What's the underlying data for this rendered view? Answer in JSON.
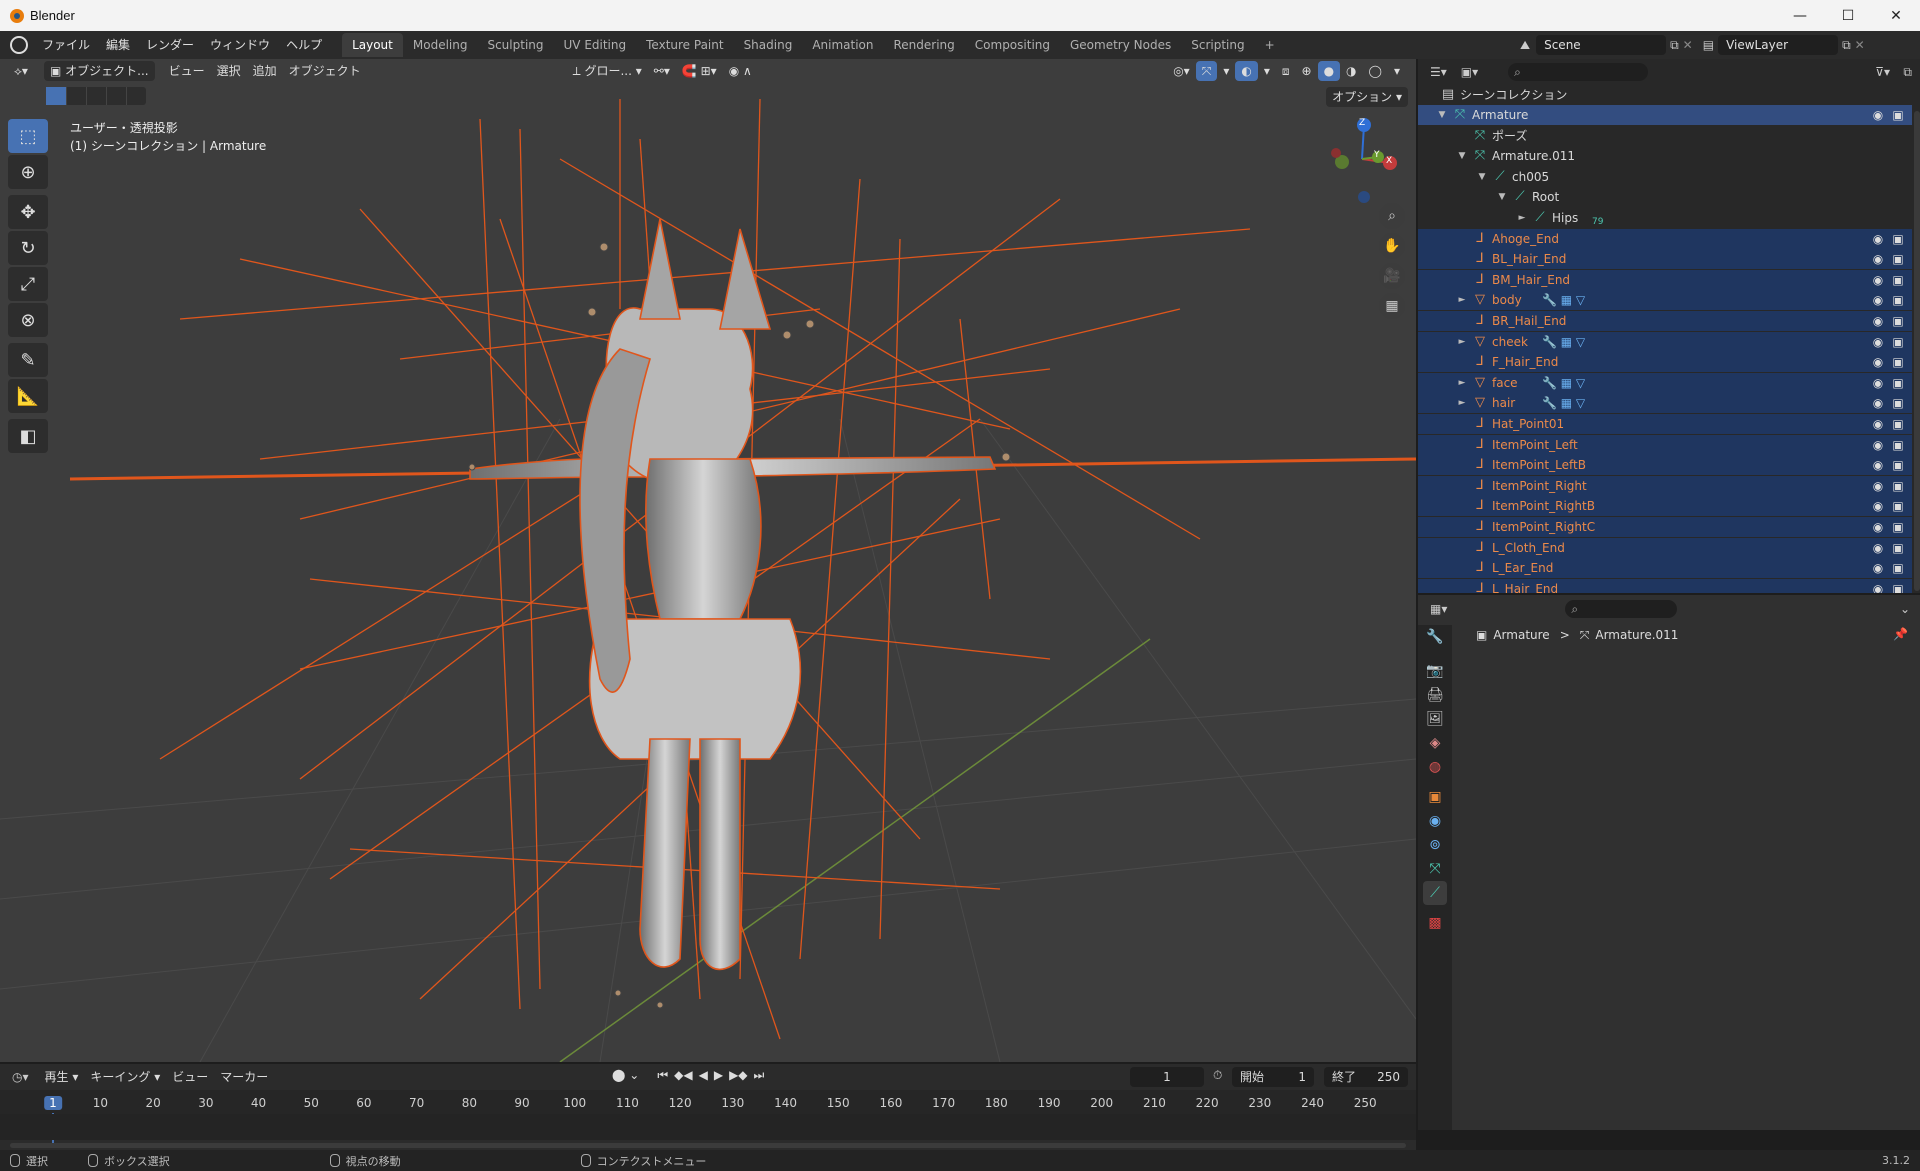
{
  "window": {
    "title": "Blender",
    "controls": [
      "—",
      "☐",
      "✕"
    ]
  },
  "menu": [
    "ファイル",
    "編集",
    "レンダー",
    "ウィンドウ",
    "ヘルプ"
  ],
  "workspaces": [
    "Layout",
    "Modeling",
    "Sculpting",
    "UV Editing",
    "Texture Paint",
    "Shading",
    "Animation",
    "Rendering",
    "Compositing",
    "Geometry Nodes",
    "Scripting",
    "+"
  ],
  "active_workspace": "Layout",
  "scene": {
    "name": "Scene",
    "view_layer": "ViewLayer"
  },
  "viewport": {
    "mode": "オブジェクト...",
    "menus": [
      "ビュー",
      "選択",
      "追加",
      "オブジェクト"
    ],
    "transform_orientation": "グロー...",
    "options_label": "オプション",
    "info_line1": "ユーザー・透視投影",
    "info_line2": "(1) シーンコレクション | Armature",
    "gizmo_axes": {
      "z": "Z",
      "x": "X",
      "y": "Y"
    }
  },
  "outliner": {
    "scene_collection": "シーンコレクション",
    "items": [
      {
        "label": "Armature",
        "depth": 0,
        "arrow": "▼",
        "icon": "armature-icon",
        "kind": "armature",
        "highlight": "active",
        "eye": true
      },
      {
        "label": "ポーズ",
        "depth": 1,
        "arrow": "",
        "icon": "pose-icon",
        "kind": "plain",
        "highlight": ""
      },
      {
        "label": "Armature.011",
        "depth": 1,
        "arrow": "▼",
        "icon": "armature-data-icon",
        "kind": "plain",
        "highlight": ""
      },
      {
        "label": "ch005",
        "depth": 2,
        "arrow": "▼",
        "icon": "bone-collection-icon",
        "kind": "plain",
        "highlight": ""
      },
      {
        "label": "Root",
        "depth": 3,
        "arrow": "▼",
        "icon": "bone-icon",
        "kind": "plain",
        "highlight": ""
      },
      {
        "label": "Hips",
        "depth": 4,
        "arrow": "►",
        "icon": "bone-icon",
        "kind": "plain",
        "highlight": "",
        "badge": "79"
      },
      {
        "label": "Ahoge_End",
        "depth": 1,
        "arrow": "",
        "icon": "empty-icon",
        "kind": "orange",
        "highlight": "sel",
        "eye": true
      },
      {
        "label": "BL_Hair_End",
        "depth": 1,
        "arrow": "",
        "icon": "empty-icon",
        "kind": "orange",
        "highlight": "sel",
        "eye": true
      },
      {
        "label": "BM_Hair_End",
        "depth": 1,
        "arrow": "",
        "icon": "empty-icon",
        "kind": "orange",
        "highlight": "sel",
        "eye": true
      },
      {
        "label": "body",
        "depth": 1,
        "arrow": "►",
        "icon": "mesh-icon",
        "kind": "orange",
        "highlight": "sel",
        "eye": true,
        "extra": true
      },
      {
        "label": "BR_Hail_End",
        "depth": 1,
        "arrow": "",
        "icon": "empty-icon",
        "kind": "orange",
        "highlight": "sel",
        "eye": true
      },
      {
        "label": "cheek",
        "depth": 1,
        "arrow": "►",
        "icon": "mesh-icon",
        "kind": "orange",
        "highlight": "sel",
        "eye": true,
        "extra": true
      },
      {
        "label": "F_Hair_End",
        "depth": 1,
        "arrow": "",
        "icon": "empty-icon",
        "kind": "orange",
        "highlight": "sel",
        "eye": true
      },
      {
        "label": "face",
        "depth": 1,
        "arrow": "►",
        "icon": "mesh-icon",
        "kind": "orange",
        "highlight": "sel",
        "eye": true,
        "extra": true
      },
      {
        "label": "hair",
        "depth": 1,
        "arrow": "►",
        "icon": "mesh-icon",
        "kind": "orange",
        "highlight": "sel",
        "eye": true,
        "extra": true
      },
      {
        "label": "Hat_Point01",
        "depth": 1,
        "arrow": "",
        "icon": "empty-icon",
        "kind": "orange",
        "highlight": "sel",
        "eye": true
      },
      {
        "label": "ItemPoint_Left",
        "depth": 1,
        "arrow": "",
        "icon": "empty-icon",
        "kind": "orange",
        "highlight": "sel",
        "eye": true
      },
      {
        "label": "ItemPoint_LeftB",
        "depth": 1,
        "arrow": "",
        "icon": "empty-icon",
        "kind": "orange",
        "highlight": "sel",
        "eye": true
      },
      {
        "label": "ItemPoint_Right",
        "depth": 1,
        "arrow": "",
        "icon": "empty-icon",
        "kind": "orange",
        "highlight": "sel",
        "eye": true
      },
      {
        "label": "ItemPoint_RightB",
        "depth": 1,
        "arrow": "",
        "icon": "empty-icon",
        "kind": "orange",
        "highlight": "sel",
        "eye": true
      },
      {
        "label": "ItemPoint_RightC",
        "depth": 1,
        "arrow": "",
        "icon": "empty-icon",
        "kind": "orange",
        "highlight": "sel",
        "eye": true
      },
      {
        "label": "L_Cloth_End",
        "depth": 1,
        "arrow": "",
        "icon": "empty-icon",
        "kind": "orange",
        "highlight": "sel",
        "eye": true
      },
      {
        "label": "L_Ear_End",
        "depth": 1,
        "arrow": "",
        "icon": "empty-icon",
        "kind": "orange",
        "highlight": "sel",
        "eye": true
      },
      {
        "label": "L_Hair_End",
        "depth": 1,
        "arrow": "",
        "icon": "empty-icon",
        "kind": "orange",
        "highlight": "sel",
        "eye": true
      }
    ]
  },
  "properties": {
    "breadcrumb_object": "Armature",
    "breadcrumb_separator": ">",
    "breadcrumb_data": "Armature.011"
  },
  "timeline": {
    "menus": [
      "再生",
      "キーイング",
      "ビュー",
      "マーカー"
    ],
    "current_frame": "1",
    "start_label": "開始",
    "start": "1",
    "end_label": "終了",
    "end": "250",
    "ticks": [
      "1",
      "10",
      "20",
      "30",
      "40",
      "50",
      "60",
      "70",
      "80",
      "90",
      "100",
      "110",
      "120",
      "130",
      "140",
      "150",
      "160",
      "170",
      "180",
      "190",
      "200",
      "210",
      "220",
      "230",
      "240",
      "250"
    ]
  },
  "status": {
    "select": "選択",
    "box_select": "ボックス選択",
    "move_view": "視点の移動",
    "context_menu": "コンテクストメニュー",
    "version": "3.1.2"
  },
  "colors": {
    "accent": "#4772b3",
    "selection": "#334d80",
    "object_orange": "#ec8a4a",
    "bone_teal": "#4dc8b0"
  }
}
